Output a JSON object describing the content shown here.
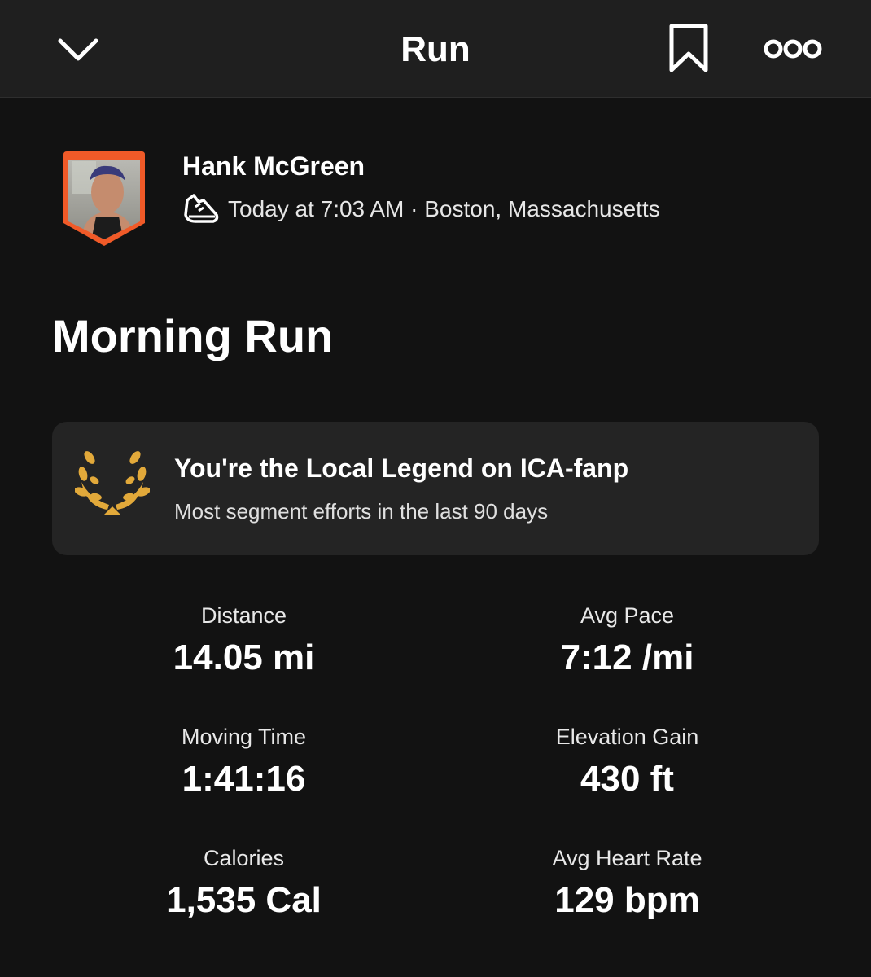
{
  "header": {
    "title": "Run",
    "back_icon": "chevron-down-icon",
    "bookmark_icon": "bookmark-icon",
    "more_icon": "more-options-icon"
  },
  "athlete": {
    "name": "Hank McGreen",
    "activity_icon": "run-shoe-icon",
    "meta": "Today at 7:03 AM · Boston, Massachusetts",
    "avatar_border_color": "#f05a28"
  },
  "activity": {
    "title": "Morning Run"
  },
  "local_legend": {
    "icon": "laurel-icon",
    "icon_color": "#e2a93a",
    "heading": "You're the Local Legend on ICA-fanp",
    "subtext": "Most segment efforts in the last 90 days"
  },
  "stats": [
    {
      "label": "Distance",
      "value": "14.05 mi"
    },
    {
      "label": "Avg Pace",
      "value": "7:12 /mi"
    },
    {
      "label": "Moving Time",
      "value": "1:41:16"
    },
    {
      "label": "Elevation Gain",
      "value": "430 ft"
    },
    {
      "label": "Calories",
      "value": "1,535 Cal"
    },
    {
      "label": "Avg Heart Rate",
      "value": "129 bpm"
    }
  ]
}
